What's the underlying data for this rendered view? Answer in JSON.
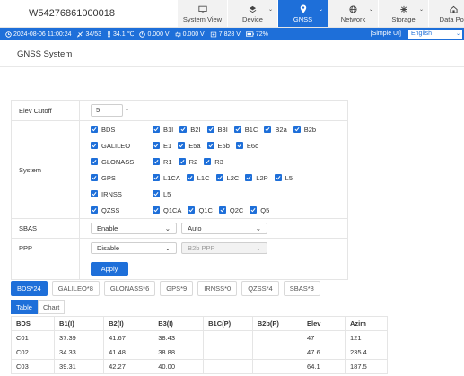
{
  "header": {
    "device_id": "W54276861000018"
  },
  "nav": [
    {
      "label": "System View",
      "icon": "monitor-icon",
      "active": false,
      "chevron": false
    },
    {
      "label": "Device",
      "icon": "device-icon",
      "active": false,
      "chevron": true
    },
    {
      "label": "GNSS",
      "icon": "location-pin-icon",
      "active": true,
      "chevron": true
    },
    {
      "label": "Network",
      "icon": "globe-icon",
      "active": false,
      "chevron": true
    },
    {
      "label": "Storage",
      "icon": "storage-icon",
      "active": false,
      "chevron": true
    },
    {
      "label": "Data Port",
      "icon": "data-port-icon",
      "active": false,
      "chevron": false
    }
  ],
  "status": {
    "datetime": "2024-08-06 11:00:24",
    "satellites": "34/53",
    "temperature": "34.1 ℃",
    "voltage1": "0.000 V",
    "voltage2": "0.000 V",
    "voltage3": "7.828 V",
    "battery": "72%",
    "simple_ui": "[Simple UI]",
    "language": "English"
  },
  "page": {
    "title": "GNSS System"
  },
  "form": {
    "elev_cutoff_label": "Elev Cutoff",
    "elev_cutoff_value": "5",
    "elev_cutoff_unit": "°",
    "system_label": "System",
    "systems": [
      {
        "name": "BDS",
        "signals": [
          "B1I",
          "B2I",
          "B3I",
          "B1C",
          "B2a",
          "B2b"
        ]
      },
      {
        "name": "GALILEO",
        "signals": [
          "E1",
          "E5a",
          "E5b",
          "E6c"
        ]
      },
      {
        "name": "GLONASS",
        "signals": [
          "R1",
          "R2",
          "R3"
        ]
      },
      {
        "name": "GPS",
        "signals": [
          "L1CA",
          "L1C",
          "L2C",
          "L2P",
          "L5"
        ]
      },
      {
        "name": "IRNSS",
        "signals": [
          "L5"
        ]
      },
      {
        "name": "QZSS",
        "signals": [
          "Q1CA",
          "Q1C",
          "Q2C",
          "Q5"
        ]
      }
    ],
    "sbas_label": "SBAS",
    "sbas_value": "Enable",
    "sbas_mode": "Auto",
    "ppp_label": "PPP",
    "ppp_value": "Disable",
    "ppp_mode": "B2b PPP",
    "apply_label": "Apply"
  },
  "sat_tabs": [
    {
      "label": "BDS*24",
      "active": true
    },
    {
      "label": "GALILEO*8",
      "active": false
    },
    {
      "label": "GLONASS*6",
      "active": false
    },
    {
      "label": "GPS*9",
      "active": false
    },
    {
      "label": "IRNSS*0",
      "active": false
    },
    {
      "label": "QZSS*4",
      "active": false
    },
    {
      "label": "SBAS*8",
      "active": false
    }
  ],
  "view_tabs": [
    {
      "label": "Table",
      "active": true
    },
    {
      "label": "Chart",
      "active": false
    }
  ],
  "table": {
    "columns": [
      "BDS",
      "B1(I)",
      "B2(I)",
      "B3(I)",
      "B1C(P)",
      "B2b(P)",
      "Elev",
      "Azim"
    ],
    "rows": [
      [
        "C01",
        "37.39",
        "41.67",
        "38.43",
        "",
        "",
        "47",
        "121"
      ],
      [
        "C02",
        "34.33",
        "41.48",
        "38.88",
        "",
        "",
        "47.6",
        "235.4"
      ],
      [
        "C03",
        "39.31",
        "42.27",
        "40.00",
        "",
        "",
        "64.1",
        "187.5"
      ]
    ]
  }
}
